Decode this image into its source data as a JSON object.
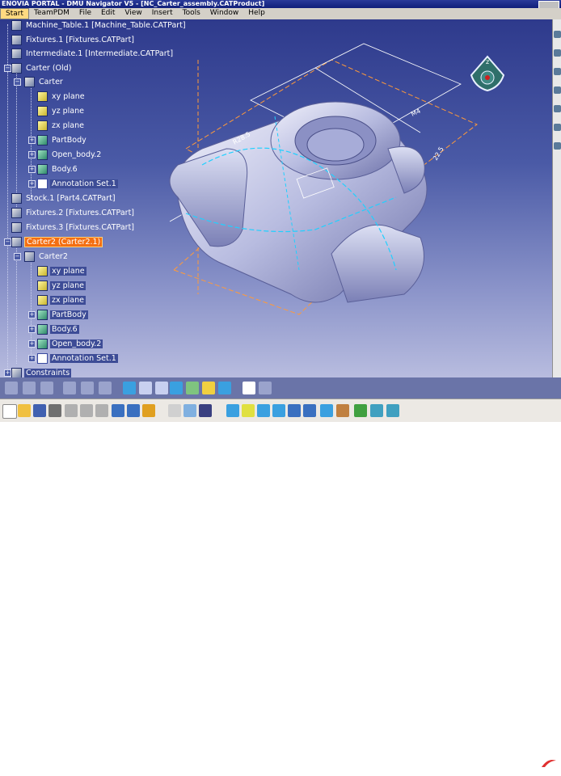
{
  "window": {
    "title": "ENOVIA PORTAL - DMU Navigator V5 - [NC_Carter_assembly.CATProduct]"
  },
  "menu": [
    "Start",
    "TeamPDM",
    "File",
    "Edit",
    "View",
    "Insert",
    "Tools",
    "Window",
    "Help"
  ],
  "tree": [
    {
      "label": "Machine_Table.1 [Machine_Table.CATPart]",
      "type": "prod"
    },
    {
      "label": "Fixtures.1 [Fixtures.CATPart]",
      "type": "prod"
    },
    {
      "label": "Intermediate.1 [Intermediate.CATPart]",
      "type": "prod"
    },
    {
      "label": "Carter (Old)",
      "type": "prod"
    },
    {
      "label": "Carter",
      "type": "prod"
    },
    {
      "label": "xy plane",
      "type": "plane"
    },
    {
      "label": "yz plane",
      "type": "plane"
    },
    {
      "label": "zx plane",
      "type": "plane"
    },
    {
      "label": "PartBody",
      "type": "body"
    },
    {
      "label": "Open_body.2",
      "type": "body"
    },
    {
      "label": "Body.6",
      "type": "body"
    },
    {
      "label": "Annotation Set.1",
      "type": "ann"
    },
    {
      "label": "Stock.1 [Part4.CATPart]",
      "type": "prod"
    },
    {
      "label": "Fixtures.2 [Fixtures.CATPart]",
      "type": "prod"
    },
    {
      "label": "Fixtures.3 [Fixtures.CATPart]",
      "type": "prod"
    },
    {
      "label": "Carter2 (Carter2.1)",
      "type": "prod",
      "highlight": true
    },
    {
      "label": "Carter2",
      "type": "prod"
    },
    {
      "label": "xy plane",
      "type": "plane"
    },
    {
      "label": "yz plane",
      "type": "plane"
    },
    {
      "label": "zx plane",
      "type": "plane"
    },
    {
      "label": "PartBody",
      "type": "body"
    },
    {
      "label": "Body.6",
      "type": "body"
    },
    {
      "label": "Open_body.2",
      "type": "body"
    },
    {
      "label": "Annotation Set.1",
      "type": "ann"
    },
    {
      "label": "Constraints",
      "type": "prod"
    }
  ],
  "compass": {
    "label": "z"
  },
  "brand": {
    "text": "ENOVIA"
  }
}
